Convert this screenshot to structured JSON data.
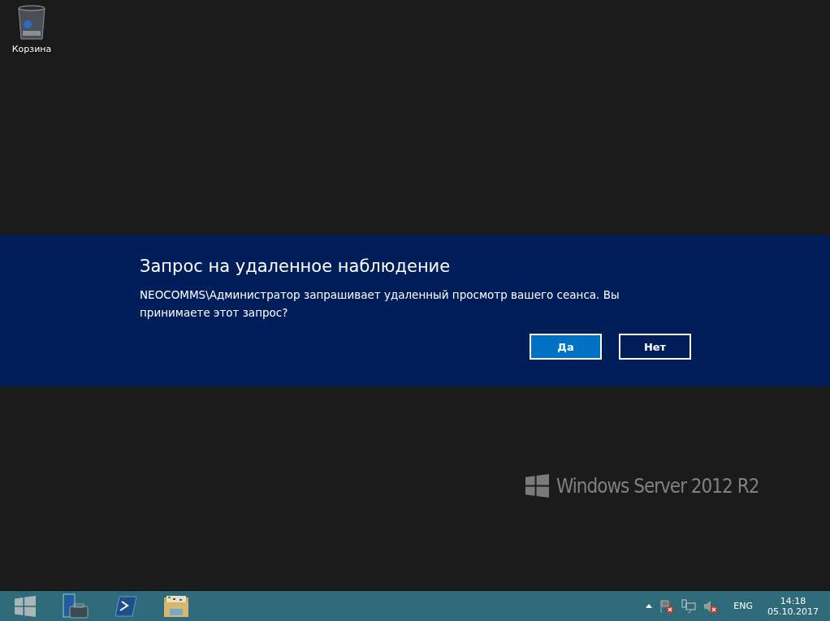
{
  "desktop_icons": [
    {
      "label": "Корзина"
    }
  ],
  "dialog": {
    "title": "Запрос на удаленное наблюдение",
    "message": "NEOCOMMS\\Администратор запрашивает удаленный просмотр вашего сеанса. Вы принимаете этот запрос?",
    "buttons": [
      {
        "label": "Да",
        "default": true
      },
      {
        "label": "Нет",
        "default": false
      }
    ]
  },
  "branding": {
    "text": "Windows Server 2012 R2"
  },
  "taskbar": {
    "pinned": [
      {
        "kind": "start"
      },
      {
        "kind": "server-manager"
      },
      {
        "kind": "powershell"
      },
      {
        "kind": "explorer"
      }
    ],
    "tray": {
      "language": "ENG",
      "time": "14:18",
      "date": "05.10.2017"
    }
  }
}
